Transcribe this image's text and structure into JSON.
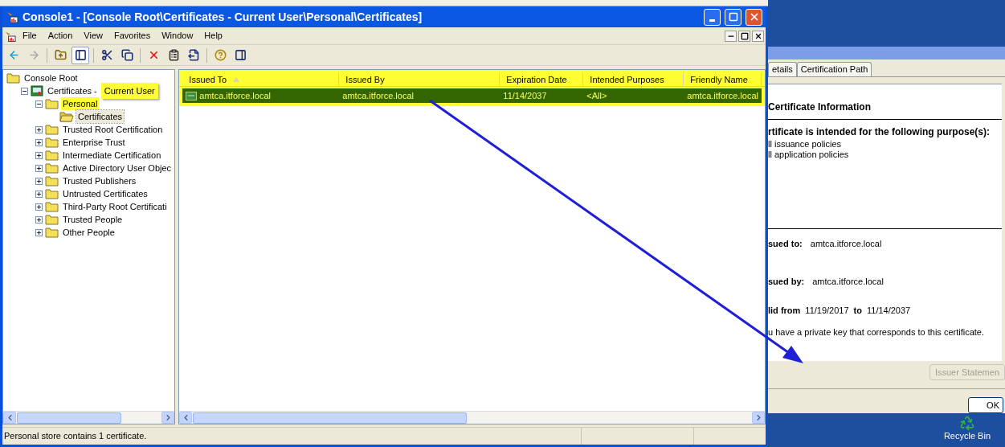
{
  "window": {
    "title": "Console1 - [Console Root\\Certificates - Current User\\Personal\\Certificates]"
  },
  "menu": [
    "File",
    "Action",
    "View",
    "Favorites",
    "Window",
    "Help"
  ],
  "toolbar": [
    {
      "kind": "back",
      "disabled": false,
      "pressed": false
    },
    {
      "kind": "forward",
      "disabled": true,
      "pressed": false
    },
    {
      "kind": "separator"
    },
    {
      "kind": "up",
      "disabled": false,
      "pressed": false
    },
    {
      "kind": "tree",
      "disabled": false,
      "pressed": true
    },
    {
      "kind": "separator"
    },
    {
      "kind": "cut",
      "disabled": false,
      "pressed": false
    },
    {
      "kind": "copy",
      "disabled": false,
      "pressed": false
    },
    {
      "kind": "separator"
    },
    {
      "kind": "delete",
      "disabled": false,
      "pressed": false
    },
    {
      "kind": "properties",
      "disabled": false,
      "pressed": false
    },
    {
      "kind": "export",
      "disabled": false,
      "pressed": false
    },
    {
      "kind": "separator"
    },
    {
      "kind": "help",
      "disabled": false,
      "pressed": false
    },
    {
      "kind": "actionpane",
      "disabled": false,
      "pressed": false
    }
  ],
  "tree": [
    {
      "label": "Console Root",
      "kind": "folder",
      "selected": false,
      "highlighted": false,
      "children": [
        {
          "label": "Certificates -",
          "annotation": "Current User",
          "kind": "store",
          "expanded": true,
          "selected": false,
          "highlighted": false,
          "children": [
            {
              "label": "Personal",
              "kind": "folder",
              "expanded": true,
              "selected": false,
              "highlighted": true,
              "children": [
                {
                  "label": "Certificates",
                  "kind": "open-folder",
                  "selected": true,
                  "highlighted": false
                }
              ]
            },
            {
              "label": "Trusted Root Certification",
              "kind": "folder",
              "expanded": false,
              "selected": false,
              "highlighted": false
            },
            {
              "label": "Enterprise Trust",
              "kind": "folder",
              "expanded": false,
              "selected": false,
              "highlighted": false
            },
            {
              "label": "Intermediate Certification",
              "kind": "folder",
              "expanded": false,
              "selected": false,
              "highlighted": false
            },
            {
              "label": "Active Directory User Objec",
              "kind": "folder",
              "expanded": false,
              "selected": false,
              "highlighted": false
            },
            {
              "label": "Trusted Publishers",
              "kind": "folder",
              "expanded": false,
              "selected": false,
              "highlighted": false
            },
            {
              "label": "Untrusted Certificates",
              "kind": "folder",
              "expanded": false,
              "selected": false,
              "highlighted": false
            },
            {
              "label": "Third-Party Root Certificati",
              "kind": "folder",
              "expanded": false,
              "selected": false,
              "highlighted": false
            },
            {
              "label": "Trusted People",
              "kind": "folder",
              "expanded": false,
              "selected": false,
              "highlighted": false
            },
            {
              "label": "Other People",
              "kind": "folder",
              "expanded": false,
              "selected": false,
              "highlighted": false
            }
          ]
        }
      ]
    }
  ],
  "list": {
    "highlighted": true,
    "columns": [
      {
        "label": "Issued To",
        "sorted": true
      },
      {
        "label": "Issued By",
        "sorted": false
      },
      {
        "label": "Expiration Date",
        "sorted": false
      },
      {
        "label": "Intended Purposes",
        "sorted": false
      },
      {
        "label": "Friendly Name",
        "sorted": false
      }
    ],
    "rows": [
      {
        "selected": true,
        "cells": [
          "amtca.itforce.local",
          "amtca.itforce.local",
          "11/14/2037",
          "<All>",
          "amtca.itforce.local"
        ]
      }
    ]
  },
  "status_bar": {
    "text": "Personal store contains 1 certificate."
  },
  "dialog": {
    "tabs": [
      {
        "label": "etails",
        "selected": false
      },
      {
        "label": "Certification Path",
        "selected": false
      }
    ],
    "heading": "Certificate Information",
    "purpose_heading": "rtificate is intended for the following purpose(s):",
    "purposes": [
      "ll issuance policies",
      "ll application policies"
    ],
    "fields": [
      {
        "label": "sued to:",
        "value": "amtca.itforce.local"
      },
      {
        "label": "sued by:",
        "value": "amtca.itforce.local"
      }
    ],
    "validity": {
      "label": "lid from",
      "from": "11/19/2017",
      "to_label": "to",
      "to": "11/14/2037"
    },
    "key_note": "u have a private key that corresponds to this certificate.",
    "issuer_button": {
      "label": "Issuer Statemen",
      "disabled": true
    },
    "ok_button": "OK"
  },
  "desktop": {
    "icons": [
      {
        "label": "Recycle Bin"
      }
    ]
  }
}
